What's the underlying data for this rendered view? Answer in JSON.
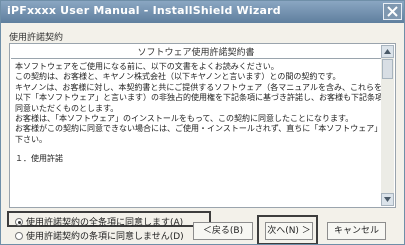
{
  "window": {
    "title": "iPFxxxx User Manual - InstallShield Wizard",
    "close_icon": "close-icon"
  },
  "section_label": "使用許諾契約",
  "license": {
    "title": "ソフトウェア使用許諾契約書",
    "lines": [
      "本ソフトウェアをご使用になる前に、以下の文書をよくお読みください。",
      "この契約は、お客様と、キヤノン株式会社（以下キヤノンと言います）との間の契約です。",
      "キヤノンは、お客様に対し、本契約書と共にご提供するソフトウェア（各マニュアルを含み、これらを総称して",
      "以下「本ソフトウェア」と言います）の非独占的使用権を下記条項に基づき許諾し、お客様も下記条項にご",
      "同意いただくものとします。",
      "お客様は、「本ソフトウェア」のインストールをもって、この契約に同意したことになります。",
      "お客様がこの契約に同意できない場合には、ご使用・インストールされず、直ちに「本ソフトウェア」を破棄して",
      "下さい。",
      "１．使用許諾"
    ]
  },
  "options": {
    "accept": "使用許諾契約の全条項に同意します(A)",
    "decline": "使用許諾契約の条項に同意しません(D)",
    "selected": "accept"
  },
  "buttons": {
    "back": "＜戻る(B)",
    "next": "次へ(N) ＞",
    "cancel": "キャンセル"
  }
}
